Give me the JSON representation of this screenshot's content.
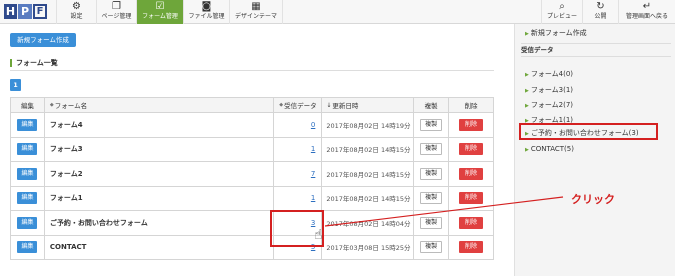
{
  "logo": {
    "letters": [
      "H",
      "P",
      "F"
    ]
  },
  "nav": [
    {
      "label": "設定",
      "icon": "gear-icon",
      "glyph": "⚙"
    },
    {
      "label": "ページ管理",
      "icon": "pages-icon",
      "glyph": "❐"
    },
    {
      "label": "フォーム管理",
      "icon": "form-icon",
      "glyph": "☑"
    },
    {
      "label": "ファイル管理",
      "icon": "camera-icon",
      "glyph": "◙"
    },
    {
      "label": "デザインテーマ",
      "icon": "design-icon",
      "glyph": "▦"
    }
  ],
  "nav_right": [
    {
      "label": "プレビュー",
      "icon": "search-icon",
      "glyph": "⌕"
    },
    {
      "label": "公開",
      "icon": "refresh-icon",
      "glyph": "↻"
    },
    {
      "label": "管理画面へ戻る",
      "icon": "back-icon",
      "glyph": "↵"
    }
  ],
  "new_form_button": "新規フォーム作成",
  "section_title": "フォーム一覧",
  "pager": {
    "current": "1"
  },
  "table": {
    "headers": {
      "edit": "編集",
      "name": "フォーム名",
      "received": "受信データ",
      "updated": "更新日時",
      "copy": "複製",
      "delete": "削除"
    },
    "rows": [
      {
        "edit": "編集",
        "name": "フォーム4",
        "received": "0",
        "updated": "2017年08月02日 14時19分",
        "copy": "複製",
        "delete": "削除"
      },
      {
        "edit": "編集",
        "name": "フォーム3",
        "received": "1",
        "updated": "2017年08月02日 14時15分",
        "copy": "複製",
        "delete": "削除"
      },
      {
        "edit": "編集",
        "name": "フォーム2",
        "received": "7",
        "updated": "2017年08月02日 14時15分",
        "copy": "複製",
        "delete": "削除"
      },
      {
        "edit": "編集",
        "name": "フォーム1",
        "received": "1",
        "updated": "2017年08月02日 14時15分",
        "copy": "複製",
        "delete": "削除"
      },
      {
        "edit": "編集",
        "name": "ご予約・お問い合わせフォーム",
        "received": "3",
        "updated": "2017年08月02日 14時04分",
        "copy": "複製",
        "delete": "削除"
      },
      {
        "edit": "編集",
        "name": "CONTACT",
        "received": "5",
        "updated": "2017年03月08日 15時25分",
        "copy": "複製",
        "delete": "削除"
      }
    ]
  },
  "side": {
    "new_form_link": "新規フォーム作成",
    "received_heading": "受信データ",
    "links": [
      "フォーム4(0)",
      "フォーム3(1)",
      "フォーム2(7)",
      "フォーム1(1)",
      "ご予約・お問い合わせフォーム(3)",
      "CONTACT(5)"
    ]
  },
  "annotation": {
    "click_label": "クリック"
  },
  "colors": {
    "accent_green": "#6ea63a",
    "button_blue": "#3a8fd8",
    "delete_red": "#e04040",
    "highlight_red": "#d42020"
  }
}
